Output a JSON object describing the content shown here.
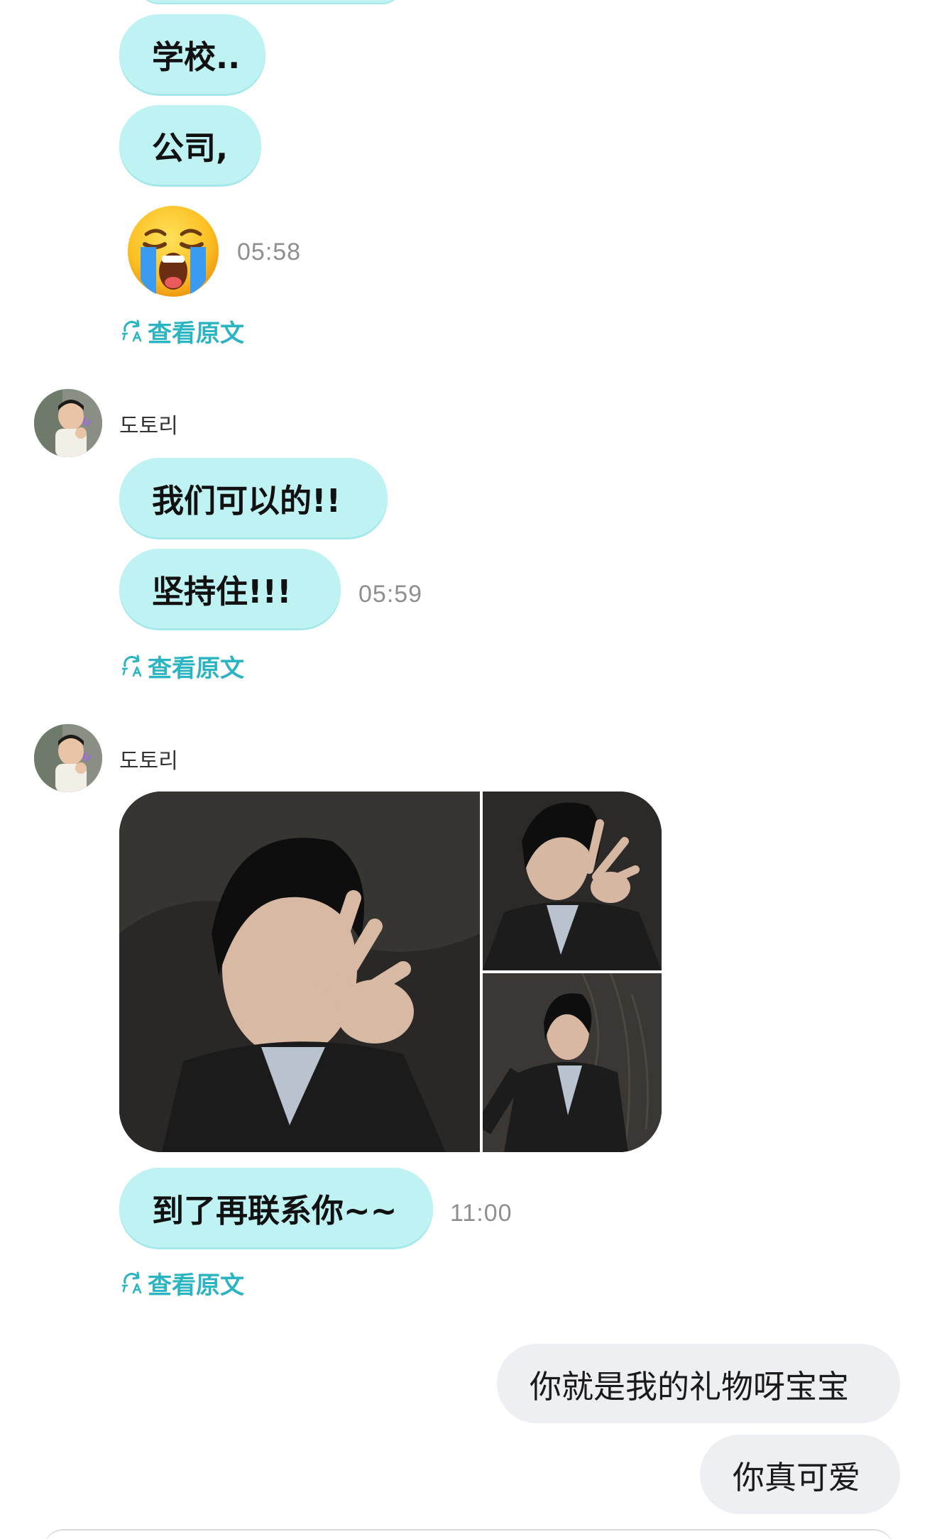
{
  "messages": {
    "m1": "学校..",
    "m2": "公司,",
    "m3_time": "05:58",
    "translate1": "查看原文",
    "sender1": "도토리",
    "m4": "我们可以的!!",
    "m5": "坚持住!!!",
    "m5_time": "05:59",
    "translate2": "查看原文",
    "sender2": "도토리",
    "m6": "到了再联系你~~",
    "m6_time": "11:00",
    "translate3": "查看原文",
    "out1": "你就是我的礼物呀宝宝",
    "out2": "你真可爱"
  },
  "icons": {
    "translate": "translate-icon",
    "emoji": "loudly-crying-face-emoji",
    "avatar": "user-avatar"
  },
  "colors": {
    "incoming_bubble": "#bff2f3",
    "outgoing_bubble": "#eeeff3",
    "accent": "#2bb4c2",
    "timestamp": "#8e8e93"
  }
}
